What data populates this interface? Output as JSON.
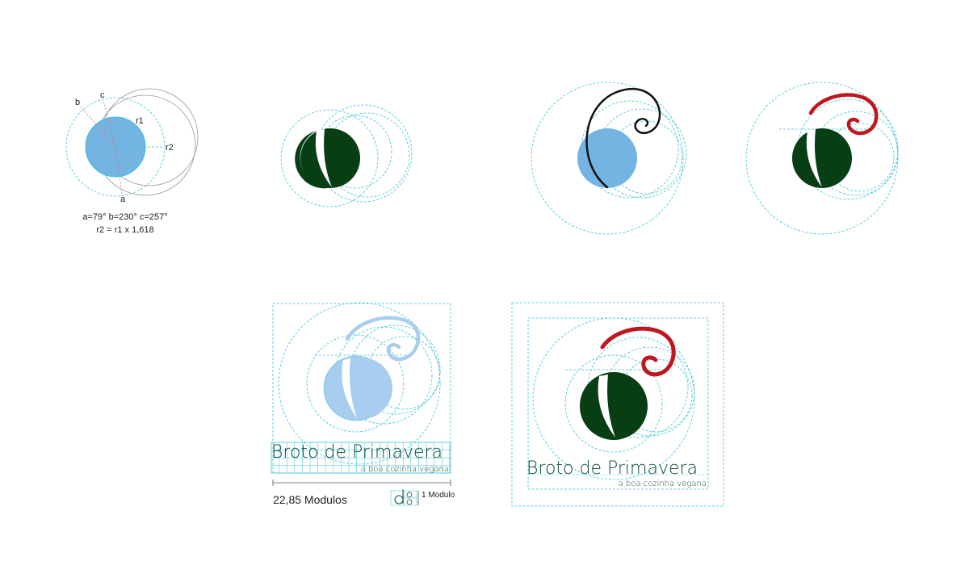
{
  "colors": {
    "guide": "#3cc3d6",
    "sketch": "#999999",
    "dark_green": "#073e14",
    "light_blue": "#73b4e3",
    "pale_blue": "#a9cdee",
    "red": "#c0171f",
    "black": "#111111",
    "brand_text": "#0e4a3a"
  },
  "construction": {
    "label_b": "b",
    "label_c": "c",
    "label_r1": "r1",
    "label_r2": "r2",
    "label_a": "a",
    "angles": "a=79° b=230° c=257°",
    "formula": "r2 = r1 x 1,618"
  },
  "brand": {
    "name": "Broto de Primavera",
    "tagline": "a boa cozinha vegana"
  },
  "module": {
    "count_label": "22,85 Modulos",
    "unit_label": "1 Modulo"
  }
}
